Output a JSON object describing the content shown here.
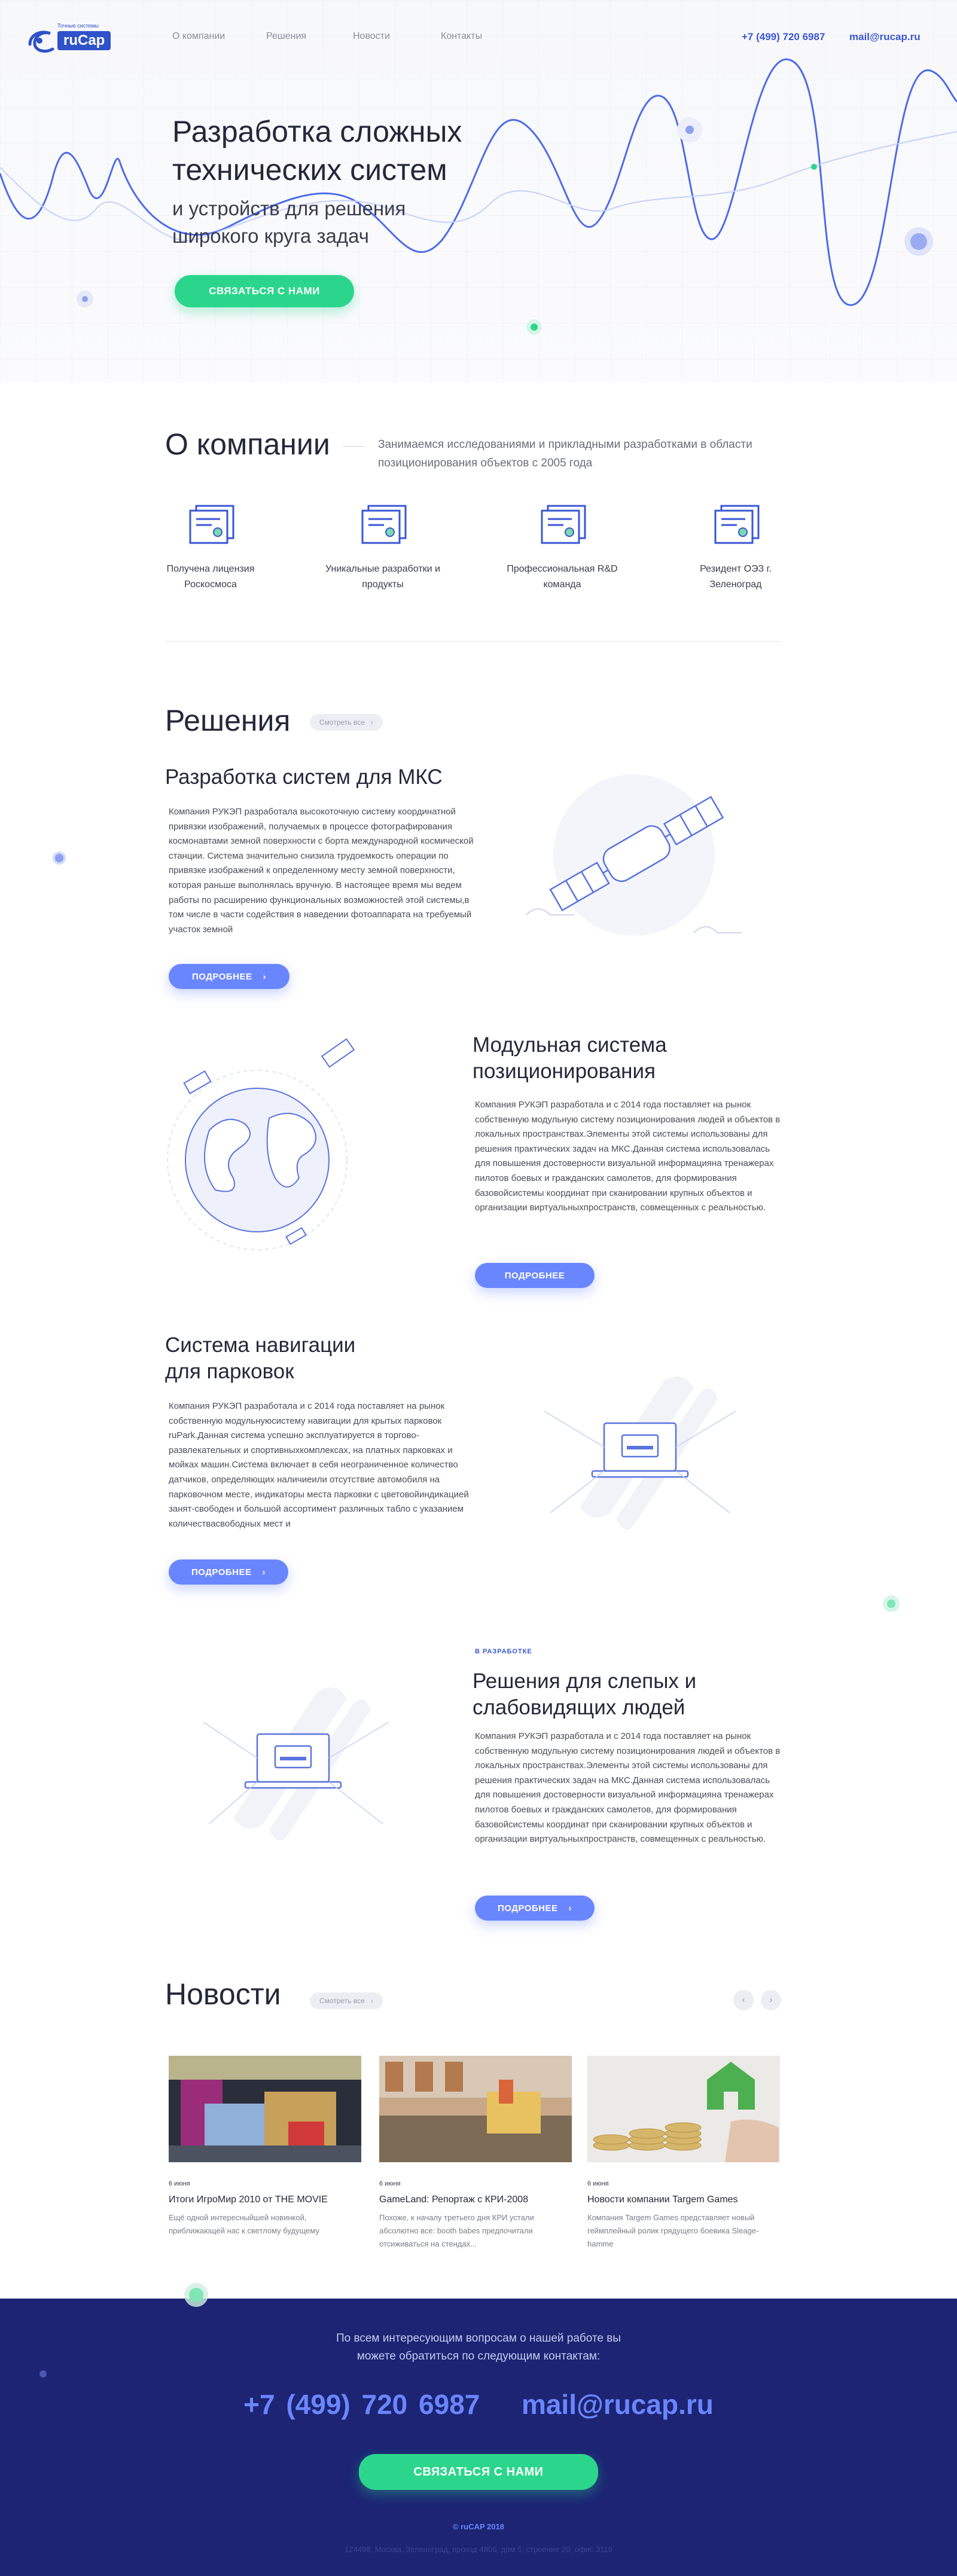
{
  "header": {
    "logo_text": "ruCap",
    "logo_tagline": "Точные системы",
    "nav": [
      "О компании",
      "Решения",
      "Новости",
      "Контакты"
    ],
    "phone": "+7 (499) 720 6987",
    "email": "mail@rucap.ru"
  },
  "hero": {
    "title": "Разработка сложных технических систем",
    "subtitle": "и устройств для решения широкого круга задач",
    "cta": "СВЯЗАТЬСЯ С НАМИ"
  },
  "about": {
    "title": "О компании",
    "description": "Занимаемся исследованиями и прикладными разработками в области позиционирования объектов с 2005 года",
    "features": [
      {
        "label": "Получена лицензия Роскосмоса"
      },
      {
        "label": "Уникальные разработки и продукты"
      },
      {
        "label": "Профессиональная R&D команда"
      },
      {
        "label": "Резидент ОЭЗ г. Зеленоград"
      }
    ]
  },
  "solutions": {
    "title": "Решения",
    "see_all": "Смотреть все",
    "more_label": "ПОДРОБНЕЕ",
    "items": [
      {
        "title": "Разработка систем для МКС",
        "text": "Компания РУКЭП разработала высокоточную систему координатной привязки изображений, получаемых в процессе фотографирования космонавтами земной поверхности с борта международной космической станции. Система значительно снизила трудоемкость операции по привязке изображений к определенному месту земной поверхности, которая раньше выполнялась вручную. В настоящее время мы ведем работы по расширению функциональных возможностей этой системы,в том числе в части содействия в наведении фотоаппарата на требуемый участок земной"
      },
      {
        "title": "Модульная система позиционирования",
        "text": "Компания РУКЭП разработала и с 2014 года поставляет на рынок собственную модульную систему позиционирования людей и объектов в локальных пространствах.Элементы этой системы использованы для решения практических задач на МКС.Данная система использовалась для повышения достоверности визуальной информацияна тренажерах пилотов боевых и гражданских самолетов, для формирования базовойсистемы координат при сканировании крупных объектов и организации виртуальныхпространств, совмещенных с реальностью."
      },
      {
        "title": "Система навигации для парковок",
        "text": "Компания РУКЭП разработала и с 2014 года поставляет на рынок собственную модульнуюсистему навигации для крытых парковок ruPark.Данная система успешно эксплуатируется в торгово-развлекательных и спортивныхкомплексах, на платных парковках и мойках машин.Система включает в себя неограниченное количество датчиков, определяющих наличиеили отсутствие автомобиля на парковочном месте, индикаторы места парковки с цветовойиндикацией занят-свободен и большой ассортимент различных табло с указанием количествасвободных мест и"
      },
      {
        "badge": "В РАЗРАБОТКЕ",
        "title": "Решения для слепых и слабовидящих людей",
        "text": "Компания РУКЭП разработала и с 2014 года поставляет на рынок собственную модульную систему позиционирования людей и объектов в локальных пространствах.Элементы этой системы использованы для решения практических задач на МКС.Данная система использовалась для повышения достоверности визуальной информацияна тренажерах пилотов боевых и гражданских самолетов, для формирования базовойсистемы координат при сканировании крупных объектов и организации виртуальныхпространств, совмещенных с реальностью."
      }
    ]
  },
  "news": {
    "title": "Новости",
    "see_all": "Смотреть все",
    "items": [
      {
        "date": "6 июня",
        "title": "Итоги ИгроМир 2010 от THE MOVIE",
        "text": "Ещё одной интересныйшей новинкой, приближающей нас к светлому будущему"
      },
      {
        "date": "6 июня",
        "title": "GameLand: Репортаж с КРИ-2008",
        "text": "Похоже, к началу третьего дня КРИ устали абсолютно все: booth babes предпочитали отсиживаться на стендах..."
      },
      {
        "date": "6 июня",
        "title": "Новости компании Targem Games",
        "text": "Компания Targem Games представляет новый геймплейный ролик грядущего боевика Sleage-hamme"
      }
    ]
  },
  "footer": {
    "intro": "По всем интересующим вопросам о нашей работе вы можете обратиться по следующим контактам:",
    "phone": "+7 (499) 720 6987",
    "email": "mail@rucap.ru",
    "cta": "СВЯЗАТЬСЯ С НАМИ",
    "copyright": "© ruCAP 2018",
    "address": "124498, Москва, Зеленоград, проезд 4806, дом 5, строение 20, офис 3119"
  },
  "colors": {
    "accent_blue": "#6a86ff",
    "brand_blue": "#2f52c9",
    "green": "#2bd68c",
    "footer_bg": "#1c2473"
  }
}
